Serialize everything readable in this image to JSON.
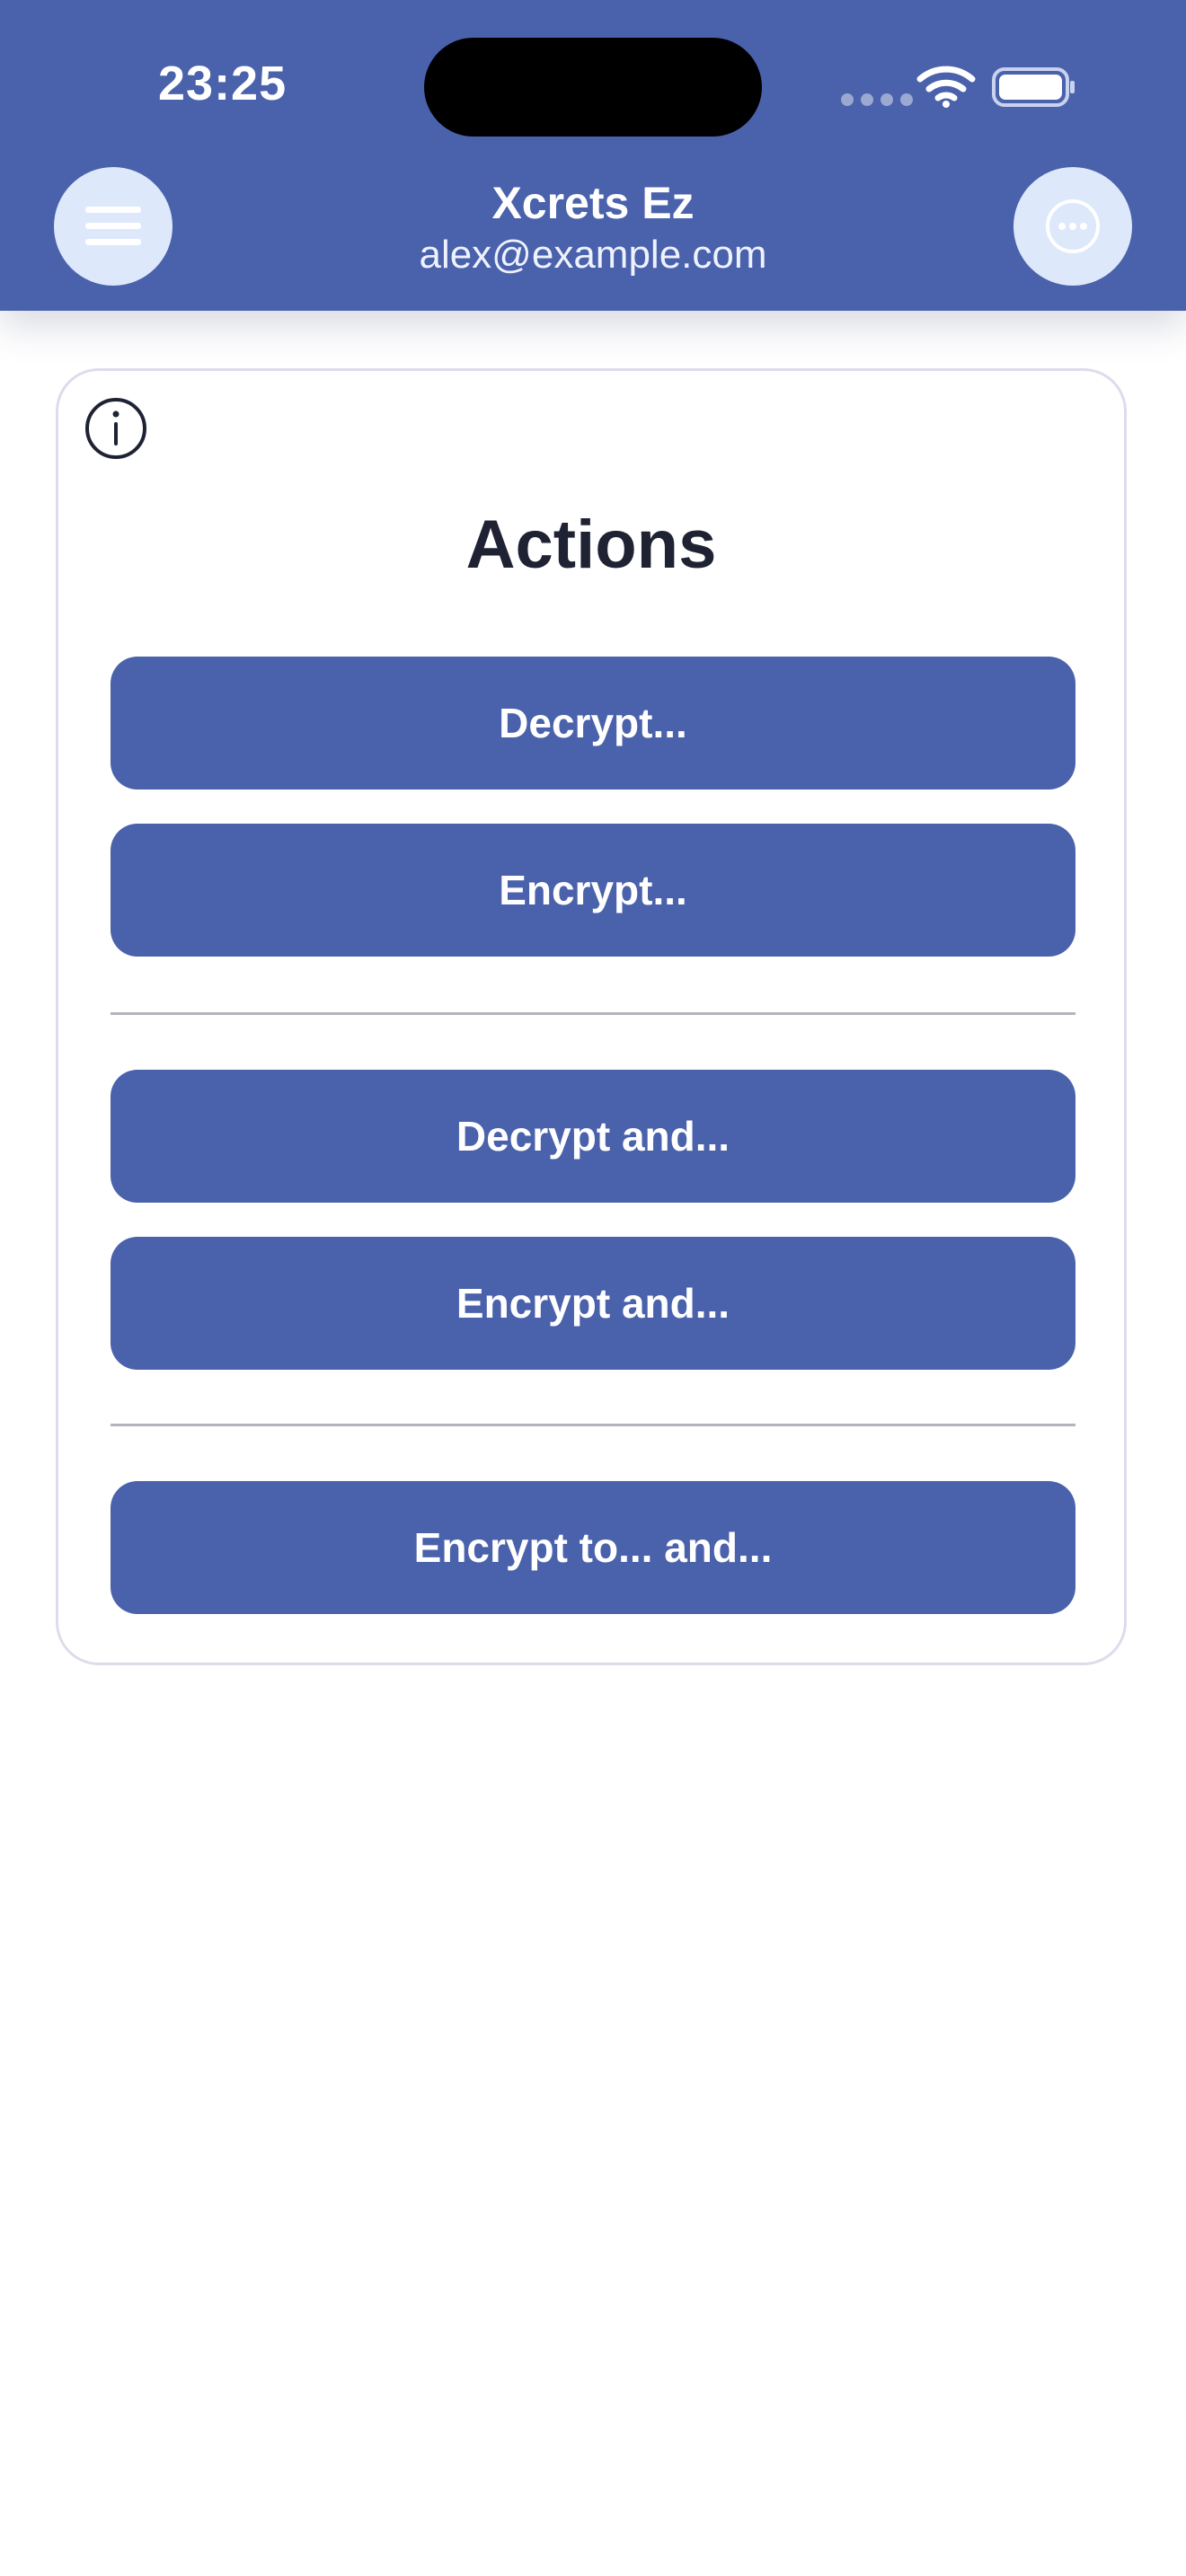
{
  "status_bar": {
    "time": "23:25"
  },
  "header": {
    "title": "Xcrets Ez",
    "subtitle": "alex@example.com",
    "menu_icon": "hamburger-menu-icon",
    "more_icon": "ellipsis-circle-icon"
  },
  "card": {
    "info_icon": "info-circle-icon",
    "title": "Actions",
    "buttons": {
      "decrypt": "Decrypt...",
      "encrypt": "Encrypt...",
      "decrypt_and": "Decrypt and...",
      "encrypt_and": "Encrypt and...",
      "encrypt_to_and": "Encrypt to... and..."
    }
  },
  "colors": {
    "brand": "#4a61ab",
    "header_button_bg": "#dde8fb",
    "title_text": "#1e2233",
    "card_border": "#dcdcec"
  }
}
